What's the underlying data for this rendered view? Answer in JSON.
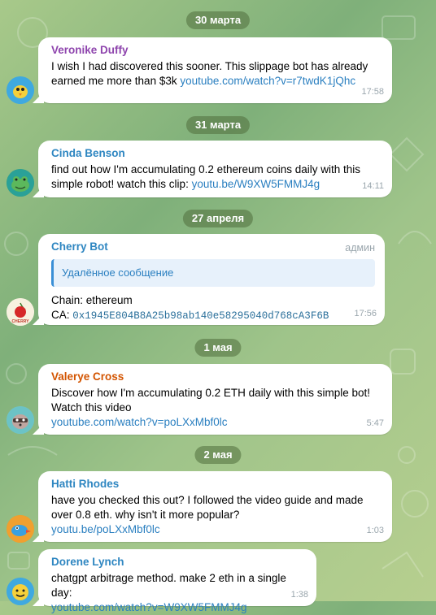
{
  "dates": [
    "30 марта",
    "31 марта",
    "27 апреля",
    "1 мая",
    "2 мая"
  ],
  "messages": [
    {
      "sender": "Veronike Duffy",
      "sender_color": "#8e44ad",
      "text": "I wish I had discovered this sooner. This slippage bot has already earned me more than $3k ",
      "link": "youtube.com/watch?v=r7twdK1jQhc",
      "time": "17:58",
      "avatar_icon": "bird-icon"
    },
    {
      "sender": "Cinda Benson",
      "sender_color": "#2e86c1",
      "text": "find out how I'm accumulating 0.2 ethereum coins daily with this simple robot! watch this clip: ",
      "link": "youtu.be/W9XW5FMMJ4g",
      "time": "14:11",
      "avatar_icon": "frog-icon"
    },
    {
      "sender": "Cherry Bot",
      "sender_color": "#2e86c1",
      "role": "админ",
      "quote": "Удалённое сообщение",
      "line1": "Chain: ethereum",
      "ca_label": "CA: ",
      "ca_value": "0x1945E804B8A25b98ab140e58295040d768cA3F6B",
      "time": "17:56",
      "avatar_icon": "cherry-icon",
      "avatar_text": "CHERRY"
    },
    {
      "sender": "Valerye Cross",
      "sender_color": "#d35400",
      "text": "Discover how I'm accumulating 0.2 ETH daily with this simple bot! Watch this video",
      "link": "youtube.com/watch?v=poLXxMbf0lc",
      "time": "5:47",
      "avatar_icon": "raccoon-icon"
    },
    {
      "sender": "Hatti Rhodes",
      "sender_color": "#2e86c1",
      "text": "have you checked this out? I followed the video guide and made over 0.8 eth. why isn't it more popular?",
      "link": "youtu.be/poLXxMbf0lc",
      "time": "1:03",
      "avatar_icon": "bird-icon"
    },
    {
      "sender": "Dorene Lynch",
      "sender_color": "#2e86c1",
      "text": "chatgpt arbitrage method. make 2 eth in a single day:",
      "link": "youtube.com/watch?v=W9XW5FMMJ4g",
      "time": "1:38",
      "avatar_icon": "smiley-icon"
    }
  ]
}
